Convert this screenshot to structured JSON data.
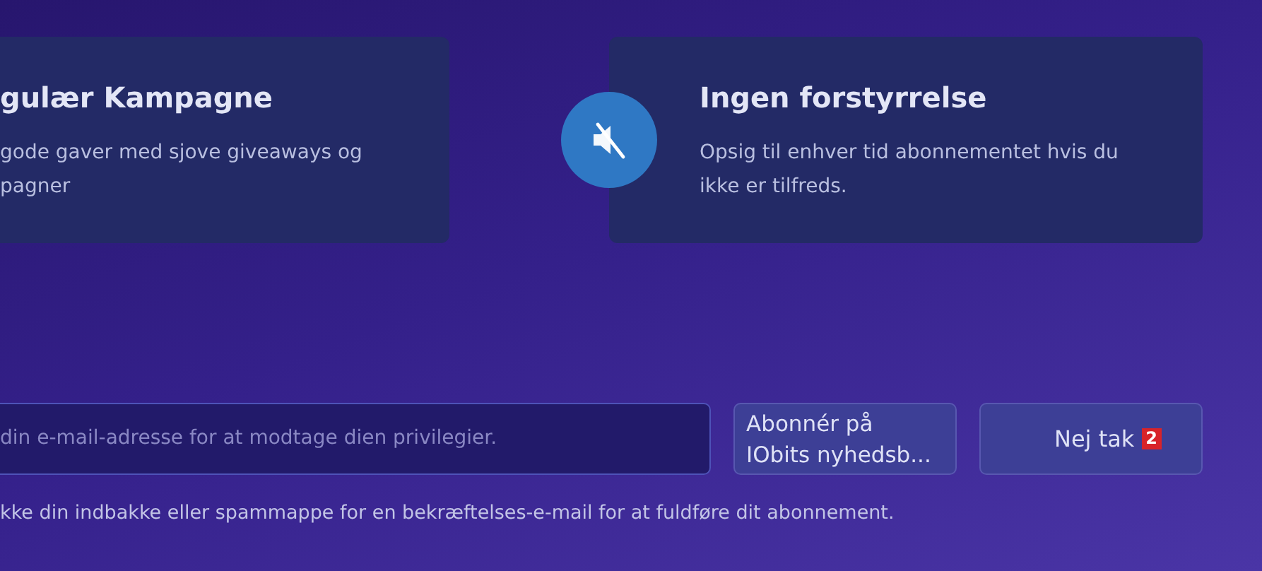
{
  "features": [
    {
      "title": "gulær Kampagne",
      "description_lines": [
        "gode gaver med sjove giveaways og",
        "pagner"
      ]
    },
    {
      "title": "Ingen forstyrrelse",
      "description_lines": [
        "Opsig til enhver tid abonnementet hvis du",
        "ikke er tilfreds."
      ]
    }
  ],
  "email_field": {
    "placeholder": "din e-mail-adresse for at modtage dien privilegier."
  },
  "subscribe_button": {
    "label_lines": [
      "Abonnér på",
      "IObits nyhedsb..."
    ]
  },
  "decline_button": {
    "label": "Nej tak",
    "badge": "2"
  },
  "note": "kke din indbakke eller spammappe for en bekræftelses-e-mail for at fuldføre dit abonnement."
}
